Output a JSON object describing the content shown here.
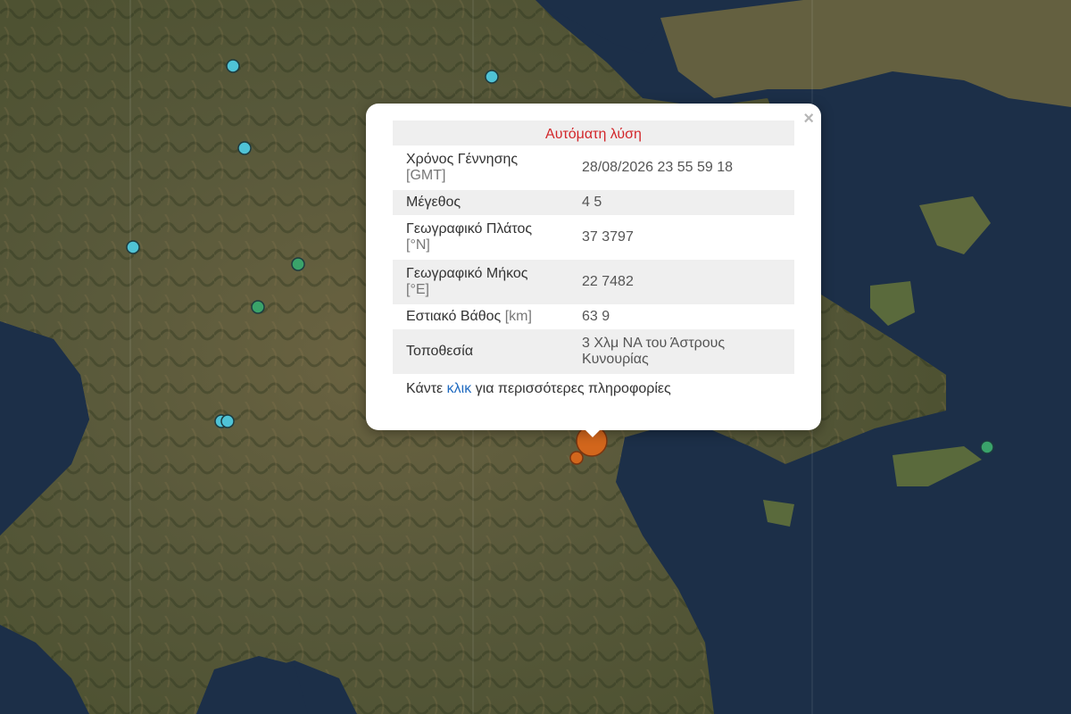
{
  "popup": {
    "title": "Αυτόματη λύση",
    "rows": [
      {
        "key": "Χρόνος Γέννησης",
        "unit": "[GMT]",
        "value": "28/08/2026 23 55 59 18"
      },
      {
        "key": "Μέγεθος",
        "unit": "",
        "value": "4 5"
      },
      {
        "key": "Γεωγραφικό Πλάτος",
        "unit": "[°N]",
        "value": "37 3797"
      },
      {
        "key": "Γεωγραφικό Μήκος",
        "unit": "[°E]",
        "value": "22 7482"
      },
      {
        "key": "Εστιακό Βάθος",
        "unit": "[km]",
        "value": "63 9"
      },
      {
        "key": "Τοποθεσία",
        "unit": "",
        "value": "3 Χλμ  ΝΑ του Άστρους Κυνουρίας"
      }
    ],
    "more_prefix": "Κάντε",
    "more_link": "κλικ",
    "more_suffix": "για περισσότερες πληροφορίες",
    "close": "×"
  },
  "map": {
    "colors": {
      "sea": "#1c2f48",
      "land": "#5e5b3a",
      "marker_cyan": "#4fc3d6",
      "marker_green": "#3aa36a",
      "marker_epicenter": "#d2661c"
    },
    "markers": [
      {
        "type": "cyan",
        "name": "station"
      },
      {
        "type": "cyan",
        "name": "station"
      },
      {
        "type": "cyan",
        "name": "station"
      },
      {
        "type": "cyan",
        "name": "station"
      },
      {
        "type": "green",
        "name": "station"
      },
      {
        "type": "green",
        "name": "station"
      },
      {
        "type": "cyan",
        "name": "station"
      },
      {
        "type": "cyan",
        "name": "station"
      },
      {
        "type": "green",
        "name": "station"
      },
      {
        "type": "epicenter",
        "name": "epicenter"
      },
      {
        "type": "epicenter-small",
        "name": "epicenter"
      }
    ]
  }
}
